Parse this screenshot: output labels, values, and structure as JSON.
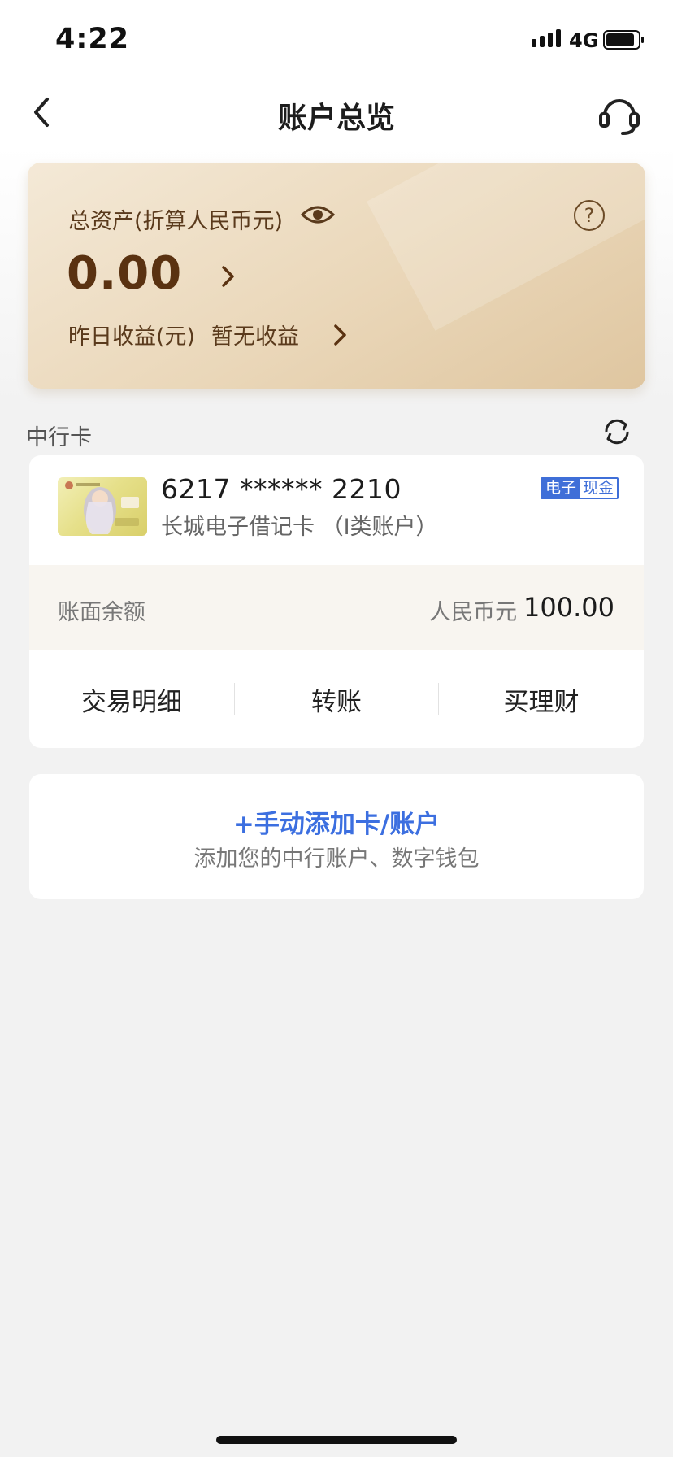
{
  "status_bar": {
    "time": "4:22",
    "network": "4G",
    "battery_level": 0.85
  },
  "header": {
    "title": "账户总览",
    "back_icon": "chevron-left-icon",
    "support_icon": "headset-icon"
  },
  "asset_card": {
    "label": "总资产(折算人民币元)",
    "value": "0.00",
    "yield_label": "昨日收益(元)",
    "yield_value": "暂无收益",
    "help_symbol": "?"
  },
  "section": {
    "title": "中行卡",
    "refresh_icon": "refresh-icon"
  },
  "card": {
    "number": "6217 ****** 2210",
    "name": "长城电子借记卡 （I类账户）",
    "badge_left": "电子",
    "badge_right": "现金",
    "balance_label": "账面余额",
    "balance_currency": "人民币元",
    "balance_value": "100.00",
    "actions": [
      "交易明细",
      "转账",
      "买理财"
    ]
  },
  "add_account": {
    "title": "+手动添加卡/账户",
    "subtitle": "添加您的中行账户、数字钱包"
  },
  "colors": {
    "accent_blue": "#3c6fe0",
    "gold_text": "#5a3211",
    "card_bg_start": "#f4e9d7",
    "card_bg_end": "#dfc6a0"
  }
}
